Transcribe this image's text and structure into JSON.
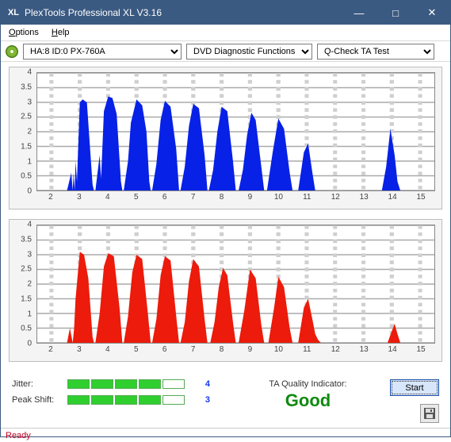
{
  "window": {
    "title": "PlexTools Professional XL V3.16"
  },
  "menu": {
    "options": "Options",
    "help": "Help"
  },
  "toolbar": {
    "drive": "HA:8 ID:0   PX-760A",
    "func": "DVD Diagnostic Functions",
    "test": "Q-Check TA Test"
  },
  "chart_data": [
    {
      "type": "area",
      "color": "#0721e7",
      "xticks": [
        2,
        3,
        4,
        5,
        6,
        7,
        8,
        9,
        10,
        11,
        12,
        13,
        14,
        15
      ],
      "yticks": [
        0,
        0.5,
        1,
        1.5,
        2,
        2.5,
        3,
        3.5,
        4
      ],
      "xrange": [
        1.5,
        15.5
      ],
      "yrange": [
        0,
        4
      ],
      "markers": [
        3,
        4,
        5,
        6,
        7,
        8,
        9,
        10,
        11,
        14
      ],
      "series": [
        [
          [
            2.55,
            0
          ],
          [
            2.7,
            0.6
          ],
          [
            2.75,
            0
          ],
          [
            2.78,
            0.6
          ],
          [
            2.82,
            0
          ],
          [
            2.85,
            1.0
          ],
          [
            2.9,
            0.3
          ],
          [
            3.0,
            3.0
          ],
          [
            3.1,
            3.1
          ],
          [
            3.25,
            3.0
          ],
          [
            3.45,
            0.2
          ],
          [
            3.5,
            0
          ]
        ],
        [
          [
            3.55,
            0
          ],
          [
            3.7,
            1.2
          ],
          [
            3.75,
            0.4
          ],
          [
            3.85,
            2.7
          ],
          [
            4.0,
            3.2
          ],
          [
            4.15,
            3.15
          ],
          [
            4.3,
            2.6
          ],
          [
            4.45,
            0.3
          ],
          [
            4.5,
            0
          ]
        ],
        [
          [
            4.55,
            0
          ],
          [
            4.7,
            1.0
          ],
          [
            4.8,
            2.3
          ],
          [
            5.0,
            3.1
          ],
          [
            5.2,
            2.9
          ],
          [
            5.35,
            2.0
          ],
          [
            5.45,
            0.3
          ],
          [
            5.5,
            0
          ]
        ],
        [
          [
            5.55,
            0
          ],
          [
            5.7,
            0.9
          ],
          [
            5.85,
            2.4
          ],
          [
            6.0,
            3.05
          ],
          [
            6.2,
            2.85
          ],
          [
            6.4,
            1.4
          ],
          [
            6.5,
            0
          ]
        ],
        [
          [
            6.55,
            0
          ],
          [
            6.7,
            0.8
          ],
          [
            6.85,
            2.2
          ],
          [
            7.0,
            2.95
          ],
          [
            7.2,
            2.8
          ],
          [
            7.4,
            1.2
          ],
          [
            7.5,
            0
          ]
        ],
        [
          [
            7.55,
            0
          ],
          [
            7.7,
            0.7
          ],
          [
            7.85,
            2.0
          ],
          [
            8.0,
            2.85
          ],
          [
            8.2,
            2.7
          ],
          [
            8.4,
            1.0
          ],
          [
            8.5,
            0
          ]
        ],
        [
          [
            8.6,
            0
          ],
          [
            8.75,
            0.7
          ],
          [
            8.9,
            1.9
          ],
          [
            9.05,
            2.65
          ],
          [
            9.2,
            2.4
          ],
          [
            9.4,
            0.8
          ],
          [
            9.5,
            0
          ]
        ],
        [
          [
            9.6,
            0
          ],
          [
            9.8,
            1.3
          ],
          [
            10.0,
            2.45
          ],
          [
            10.2,
            2.1
          ],
          [
            10.4,
            0.6
          ],
          [
            10.5,
            0
          ]
        ],
        [
          [
            10.7,
            0
          ],
          [
            10.9,
            1.3
          ],
          [
            11.05,
            1.6
          ],
          [
            11.2,
            0.6
          ],
          [
            11.3,
            0
          ]
        ],
        [
          [
            13.65,
            0
          ],
          [
            13.8,
            0.8
          ],
          [
            13.95,
            2.1
          ],
          [
            14.1,
            1.2
          ],
          [
            14.2,
            0.3
          ],
          [
            14.3,
            0
          ]
        ]
      ]
    },
    {
      "type": "area",
      "color": "#ec1b0b",
      "xticks": [
        2,
        3,
        4,
        5,
        6,
        7,
        8,
        9,
        10,
        11,
        12,
        13,
        14,
        15
      ],
      "yticks": [
        0,
        0.5,
        1,
        1.5,
        2,
        2.5,
        3,
        3.5,
        4
      ],
      "xrange": [
        1.5,
        15.5
      ],
      "yrange": [
        0,
        4
      ],
      "markers": [
        3,
        4,
        5,
        6,
        7,
        8,
        9,
        10,
        11,
        14
      ],
      "series": [
        [
          [
            2.55,
            0
          ],
          [
            2.65,
            0.5
          ],
          [
            2.75,
            0
          ],
          [
            2.8,
            0.5
          ],
          [
            2.85,
            1.5
          ],
          [
            3.0,
            3.1
          ],
          [
            3.15,
            3.0
          ],
          [
            3.3,
            2.2
          ],
          [
            3.45,
            0.2
          ],
          [
            3.5,
            0
          ]
        ],
        [
          [
            3.55,
            0
          ],
          [
            3.7,
            1.0
          ],
          [
            3.85,
            2.6
          ],
          [
            4.0,
            3.05
          ],
          [
            4.2,
            2.95
          ],
          [
            4.4,
            1.2
          ],
          [
            4.5,
            0
          ]
        ],
        [
          [
            4.55,
            0
          ],
          [
            4.7,
            0.9
          ],
          [
            4.85,
            2.4
          ],
          [
            5.0,
            3.0
          ],
          [
            5.2,
            2.85
          ],
          [
            5.4,
            1.0
          ],
          [
            5.5,
            0
          ]
        ],
        [
          [
            5.55,
            0
          ],
          [
            5.7,
            0.8
          ],
          [
            5.85,
            2.3
          ],
          [
            6.0,
            2.95
          ],
          [
            6.2,
            2.8
          ],
          [
            6.4,
            0.9
          ],
          [
            6.5,
            0
          ]
        ],
        [
          [
            6.55,
            0
          ],
          [
            6.7,
            0.7
          ],
          [
            6.85,
            2.1
          ],
          [
            7.0,
            2.85
          ],
          [
            7.2,
            2.6
          ],
          [
            7.4,
            0.8
          ],
          [
            7.5,
            0
          ]
        ],
        [
          [
            7.6,
            0
          ],
          [
            7.75,
            0.7
          ],
          [
            7.9,
            1.9
          ],
          [
            8.05,
            2.55
          ],
          [
            8.2,
            2.3
          ],
          [
            8.4,
            0.7
          ],
          [
            8.5,
            0
          ]
        ],
        [
          [
            8.6,
            0
          ],
          [
            8.8,
            1.1
          ],
          [
            9.0,
            2.5
          ],
          [
            9.2,
            2.2
          ],
          [
            9.4,
            0.6
          ],
          [
            9.5,
            0
          ]
        ],
        [
          [
            9.65,
            0
          ],
          [
            9.85,
            1.2
          ],
          [
            10.0,
            2.25
          ],
          [
            10.2,
            1.9
          ],
          [
            10.4,
            0.5
          ],
          [
            10.5,
            0
          ]
        ],
        [
          [
            10.7,
            0
          ],
          [
            10.9,
            1.2
          ],
          [
            11.05,
            1.5
          ],
          [
            11.2,
            0.8
          ],
          [
            11.3,
            0.3
          ],
          [
            11.4,
            0.1
          ],
          [
            11.5,
            0
          ]
        ],
        [
          [
            13.85,
            0
          ],
          [
            14.0,
            0.4
          ],
          [
            14.1,
            0.65
          ],
          [
            14.2,
            0.3
          ],
          [
            14.3,
            0
          ]
        ]
      ]
    }
  ],
  "metrics": {
    "jitter_label": "Jitter:",
    "jitter_value": "4",
    "jitter_filled": 4,
    "jitter_total": 5,
    "peak_label": "Peak Shift:",
    "peak_value": "3",
    "peak_filled": 4,
    "peak_total": 5
  },
  "ta": {
    "label": "TA Quality Indicator:",
    "value": "Good"
  },
  "buttons": {
    "start": "Start"
  },
  "status": {
    "text": "Ready"
  }
}
